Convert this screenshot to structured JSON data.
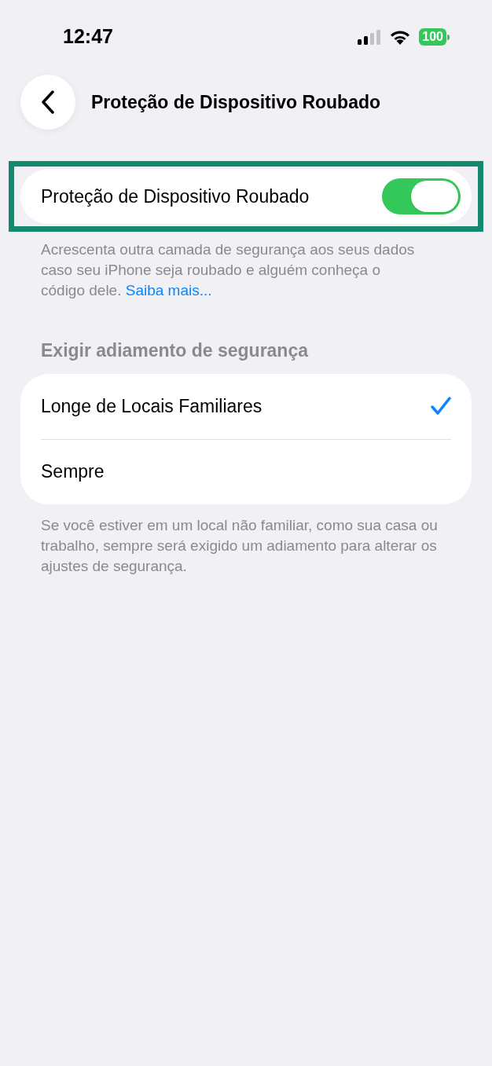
{
  "status_bar": {
    "time": "12:47",
    "battery": "100"
  },
  "nav": {
    "title": "Proteção de Dispositivo Roubado"
  },
  "toggle_row": {
    "label": "Proteção de Dispositivo Roubado",
    "on": true,
    "highlighted": true
  },
  "description": {
    "text": "Acrescenta outra camada de segurança aos seus dados caso seu iPhone seja roubado e alguém conheça o código dele.",
    "link": "Saiba mais..."
  },
  "delay_section": {
    "header": "Exigir adiamento de segurança",
    "options": [
      {
        "label": "Longe de Locais Familiares",
        "selected": true
      },
      {
        "label": "Sempre",
        "selected": false
      }
    ],
    "footer": "Se você estiver em um local não familiar, como sua casa ou trabalho, sempre será exigido um adiamento para alterar os ajustes de segurança."
  }
}
